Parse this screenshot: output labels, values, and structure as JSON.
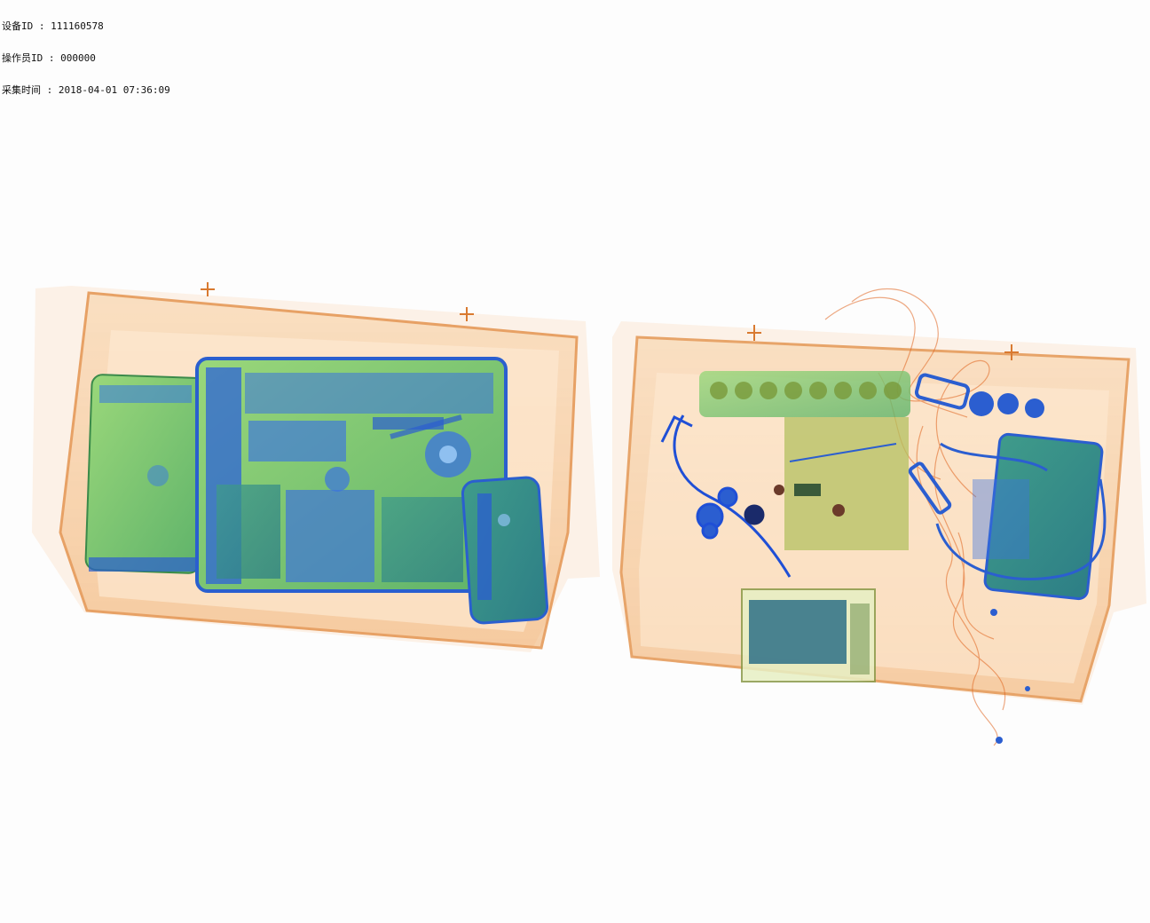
{
  "overlay": {
    "device_id": "设备ID : 111160578",
    "operator_id": "操作员ID : 000000",
    "capture_time": "采集时间 : 2018-04-01 07:36:09"
  },
  "colors": {
    "background": "#fdfdfd",
    "organic": "#e88a3c",
    "mixed": "#7cc35a",
    "metal": "#1d4fd6"
  }
}
